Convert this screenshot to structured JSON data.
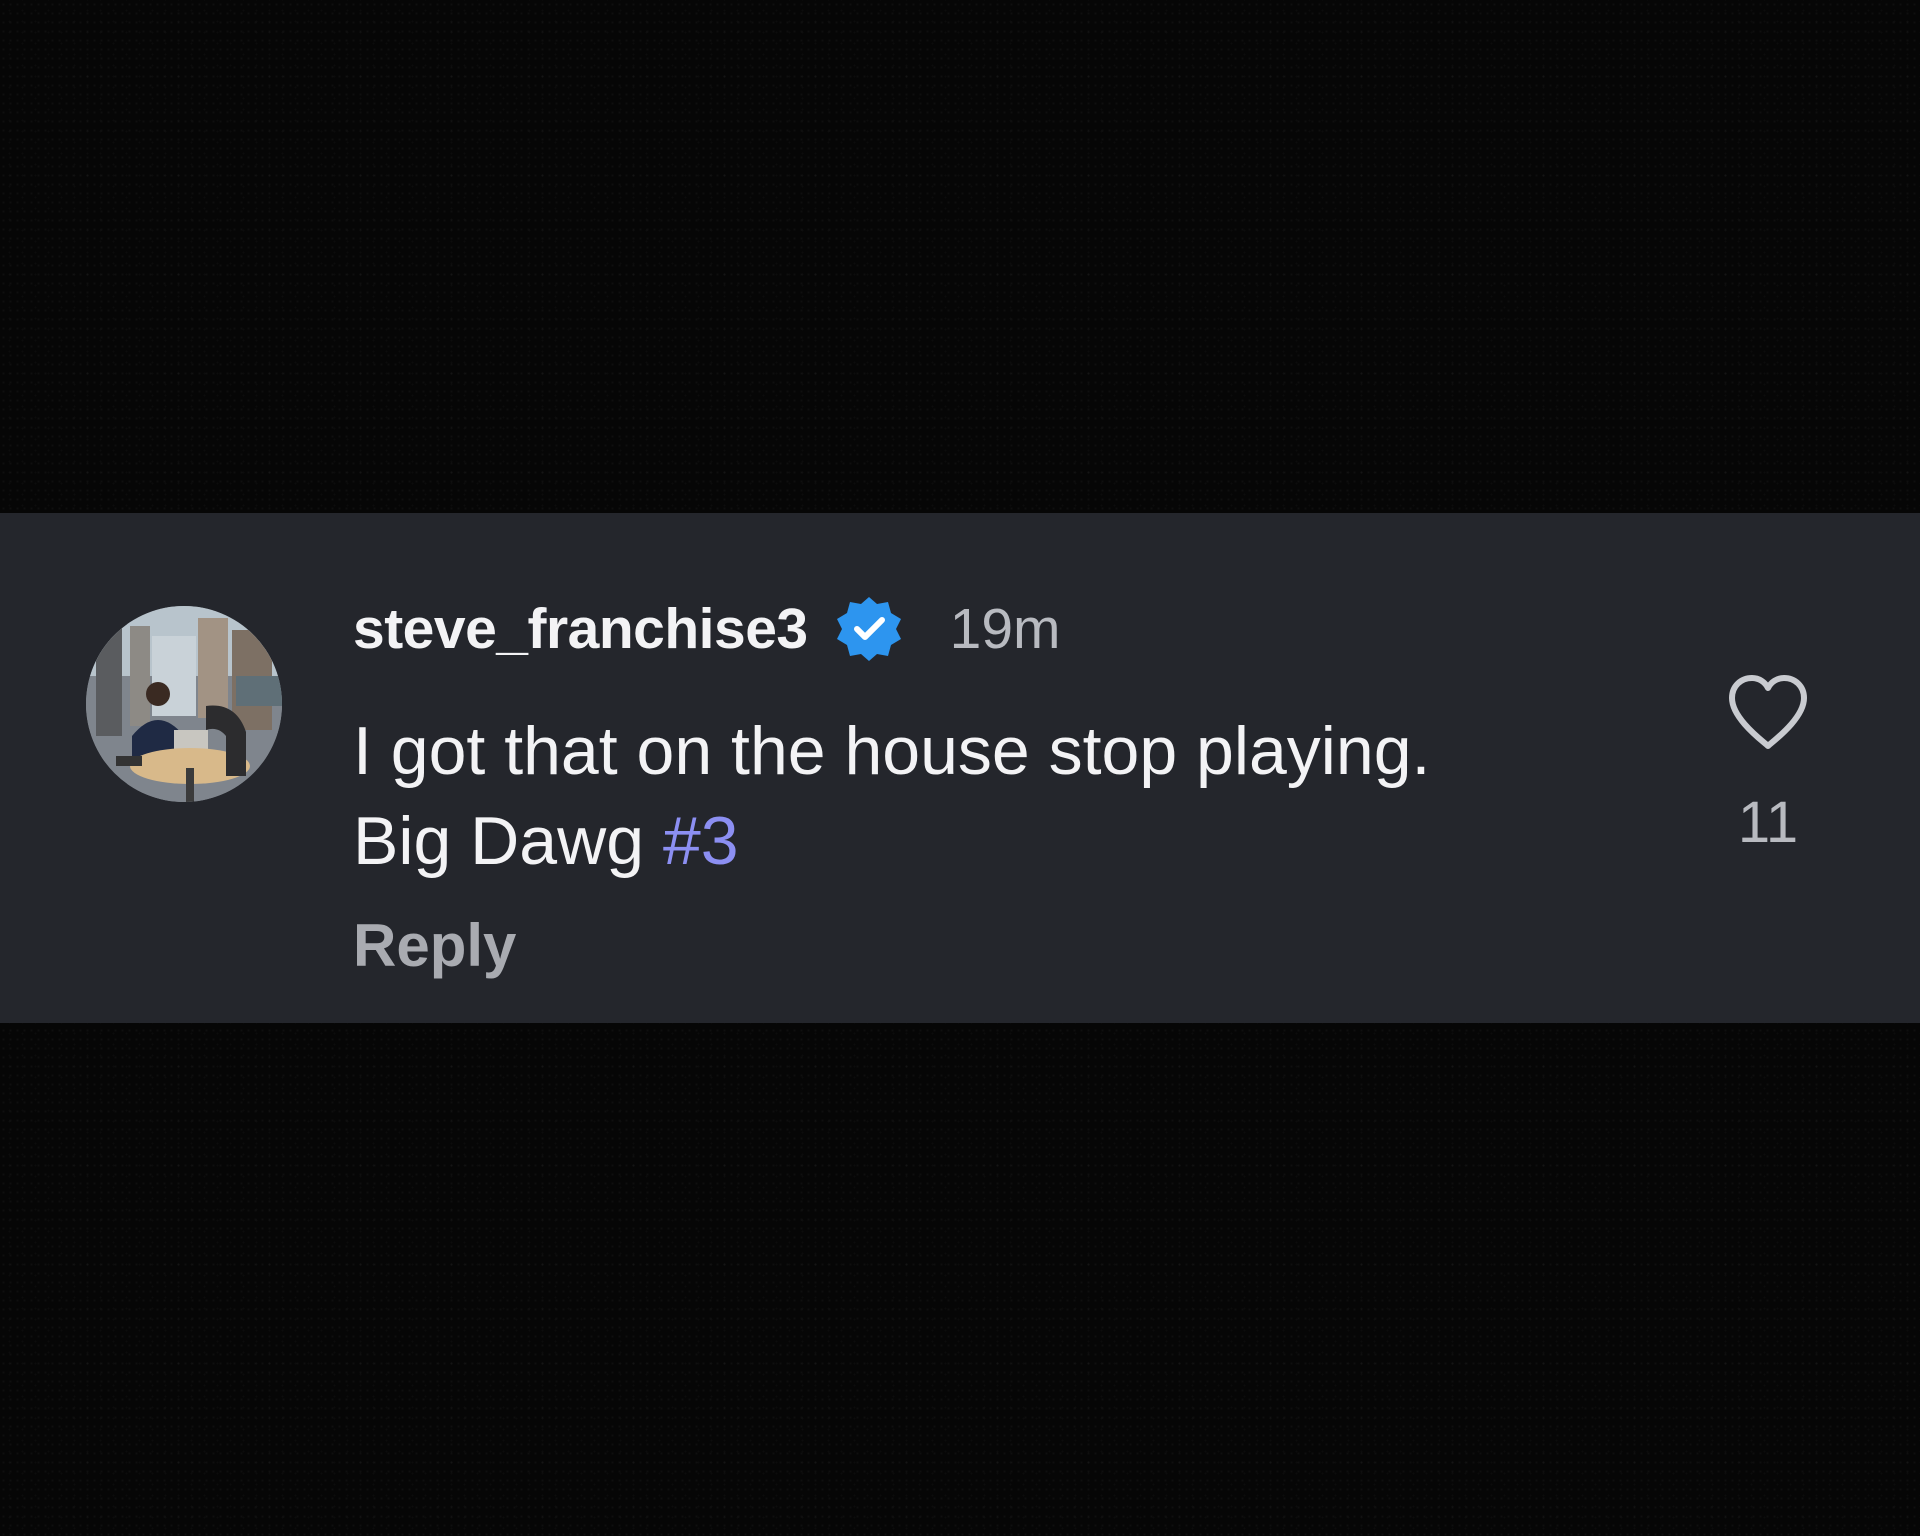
{
  "comment": {
    "username": "steve_franchise3",
    "verified_icon": "verified-badge-icon",
    "timestamp": "19m",
    "text_line1": "I got that on the house stop playing.",
    "text_line2_prefix": "Big Dawg",
    "hashtag": "#3",
    "reply_label": "Reply",
    "like_icon": "heart-outline-icon",
    "like_count": "11"
  },
  "colors": {
    "background": "#060606",
    "panel": "#24262c",
    "verified_badge": "#2d95ef",
    "hashtag": "#8c8ff2",
    "secondary_text": "#b8bac0"
  }
}
